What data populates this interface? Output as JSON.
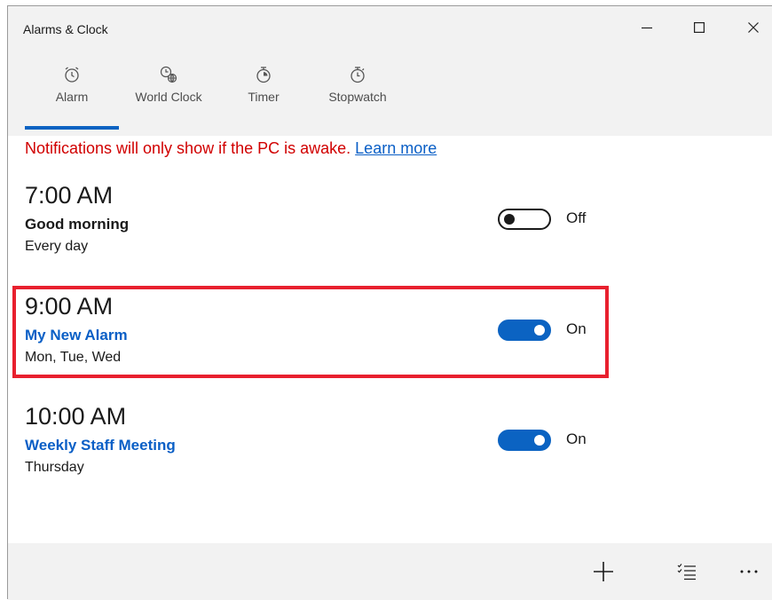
{
  "window": {
    "title": "Alarms & Clock"
  },
  "tabs": [
    {
      "label": "Alarm",
      "icon": "alarm-clock-icon",
      "selected": true
    },
    {
      "label": "World Clock",
      "icon": "world-clock-icon",
      "selected": false
    },
    {
      "label": "Timer",
      "icon": "timer-icon",
      "selected": false
    },
    {
      "label": "Stopwatch",
      "icon": "stopwatch-icon",
      "selected": false
    }
  ],
  "notice": {
    "text": "Notifications will only show if the PC is awake.",
    "link": "Learn more"
  },
  "alarms": [
    {
      "time": "7:00 AM",
      "name": "Good morning",
      "days": "Every day",
      "state": "Off",
      "on": false,
      "name_color": "#1a1a1a"
    },
    {
      "time": "9:00 AM",
      "name": "My New Alarm",
      "days": "Mon, Tue, Wed",
      "state": "On",
      "on": true,
      "name_color": "#0a5fc6"
    },
    {
      "time": "10:00 AM",
      "name": "Weekly Staff Meeting",
      "days": "Thursday",
      "state": "On",
      "on": true,
      "name_color": "#0a5fc6"
    }
  ],
  "colors": {
    "accent": "#0b63c2",
    "notice": "#d10000",
    "highlight": "#e8202e",
    "chrome": "#f2f2f2"
  },
  "bottombar": {
    "add": "add-icon",
    "select": "select-list-icon",
    "more": "more-icon"
  }
}
